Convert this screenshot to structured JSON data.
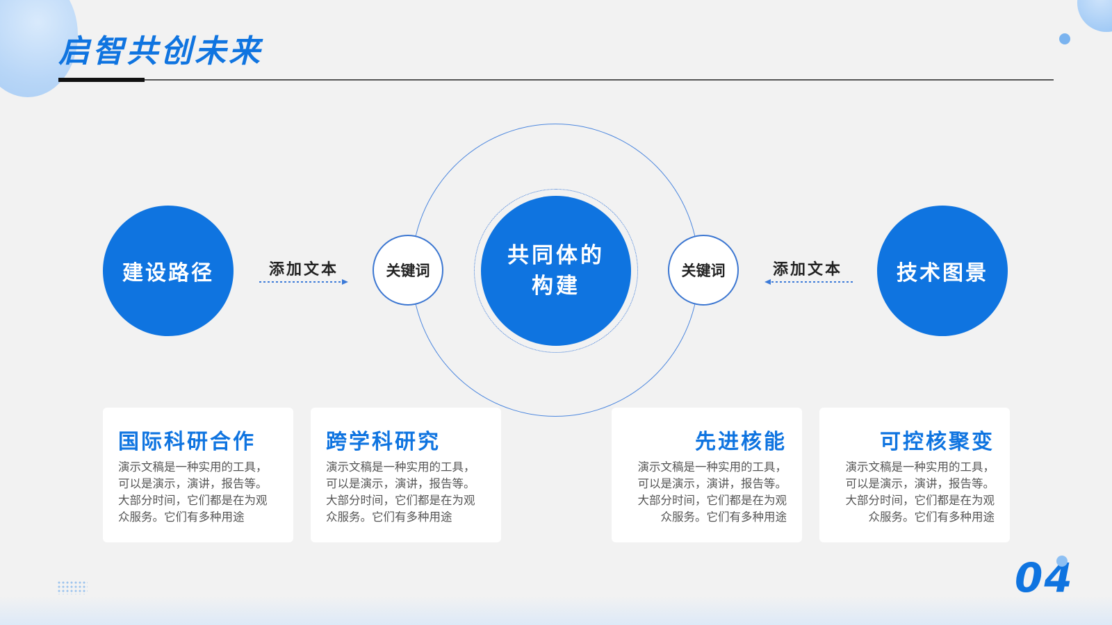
{
  "header": {
    "title": "启智共创未来"
  },
  "center": {
    "line1": "共同体的",
    "line2": "构建"
  },
  "left": {
    "circle_label": "建设路径",
    "add_text": "添加文本",
    "keyword": "关键词"
  },
  "right": {
    "circle_label": "技术图景",
    "add_text": "添加文本",
    "keyword": "关键词"
  },
  "cards": [
    {
      "title": "国际科研合作",
      "desc": "演示文稿是一种实用的工具，可以是演示，演讲，报告等。大部分时间，它们都是在为观众服务。它们有多种用途"
    },
    {
      "title": "跨学科研究",
      "desc": "演示文稿是一种实用的工具，可以是演示，演讲，报告等。大部分时间，它们都是在为观众服务。它们有多种用途"
    },
    {
      "title": "先进核能",
      "desc": "演示文稿是一种实用的工具，可以是演示，演讲，报告等。大部分时间，它们都是在为观众服务。它们有多种用途"
    },
    {
      "title": "可控核聚变",
      "desc": "演示文稿是一种实用的工具，可以是演示，演讲，报告等。大部分时间，它们都是在为观众服务。它们有多种用途"
    }
  ],
  "page_number": "04",
  "colors": {
    "accent": "#0f74e0",
    "background": "#f2f2f2",
    "ring": "#4b86de"
  }
}
